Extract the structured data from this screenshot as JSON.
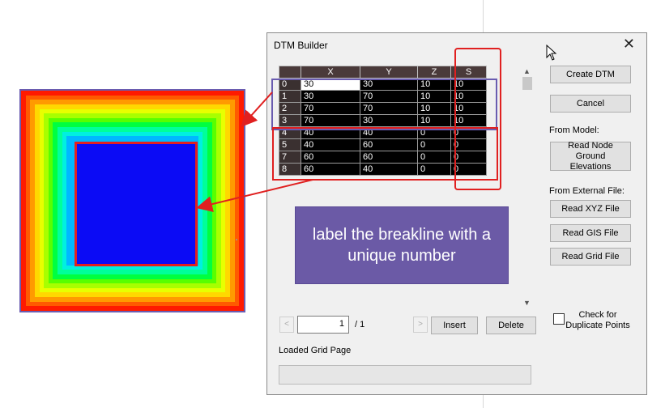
{
  "dialog": {
    "title": "DTM Builder",
    "close_glyph": "✕"
  },
  "grid": {
    "columns": [
      "",
      "X",
      "Y",
      "Z",
      "S"
    ],
    "rows": [
      {
        "idx": "0",
        "x": "30",
        "y": "30",
        "z": "10",
        "s": "10"
      },
      {
        "idx": "1",
        "x": "30",
        "y": "70",
        "z": "10",
        "s": "10"
      },
      {
        "idx": "2",
        "x": "70",
        "y": "70",
        "z": "10",
        "s": "10"
      },
      {
        "idx": "3",
        "x": "70",
        "y": "30",
        "z": "10",
        "s": "10"
      },
      {
        "idx": "4",
        "x": "40",
        "y": "40",
        "z": "0",
        "s": "0"
      },
      {
        "idx": "5",
        "x": "40",
        "y": "60",
        "z": "0",
        "s": "0"
      },
      {
        "idx": "7",
        "x": "60",
        "y": "60",
        "z": "0",
        "s": "0"
      },
      {
        "idx": "8",
        "x": "60",
        "y": "40",
        "z": "0",
        "s": "0"
      }
    ]
  },
  "annotation": {
    "text": "label the breakline with a unique number"
  },
  "buttons": {
    "create": "Create DTM",
    "cancel": "Cancel",
    "read_node": "Read Node Ground Elevations",
    "read_xyz": "Read XYZ File",
    "read_gis": "Read GIS File",
    "read_grid": "Read Grid File",
    "insert": "Insert",
    "delete": "Delete",
    "prev": "<",
    "next": ">"
  },
  "labels": {
    "from_model": "From Model:",
    "from_external": "From External File:",
    "check_duplicates": "Check for Duplicate Points",
    "status": "Loaded Grid Page"
  },
  "pager": {
    "current": "1",
    "total": "/ 1"
  },
  "colors": {
    "annotation_bg": "#6b5aa6",
    "highlight_red": "#e02020",
    "highlight_purple": "#6a5cb0"
  }
}
